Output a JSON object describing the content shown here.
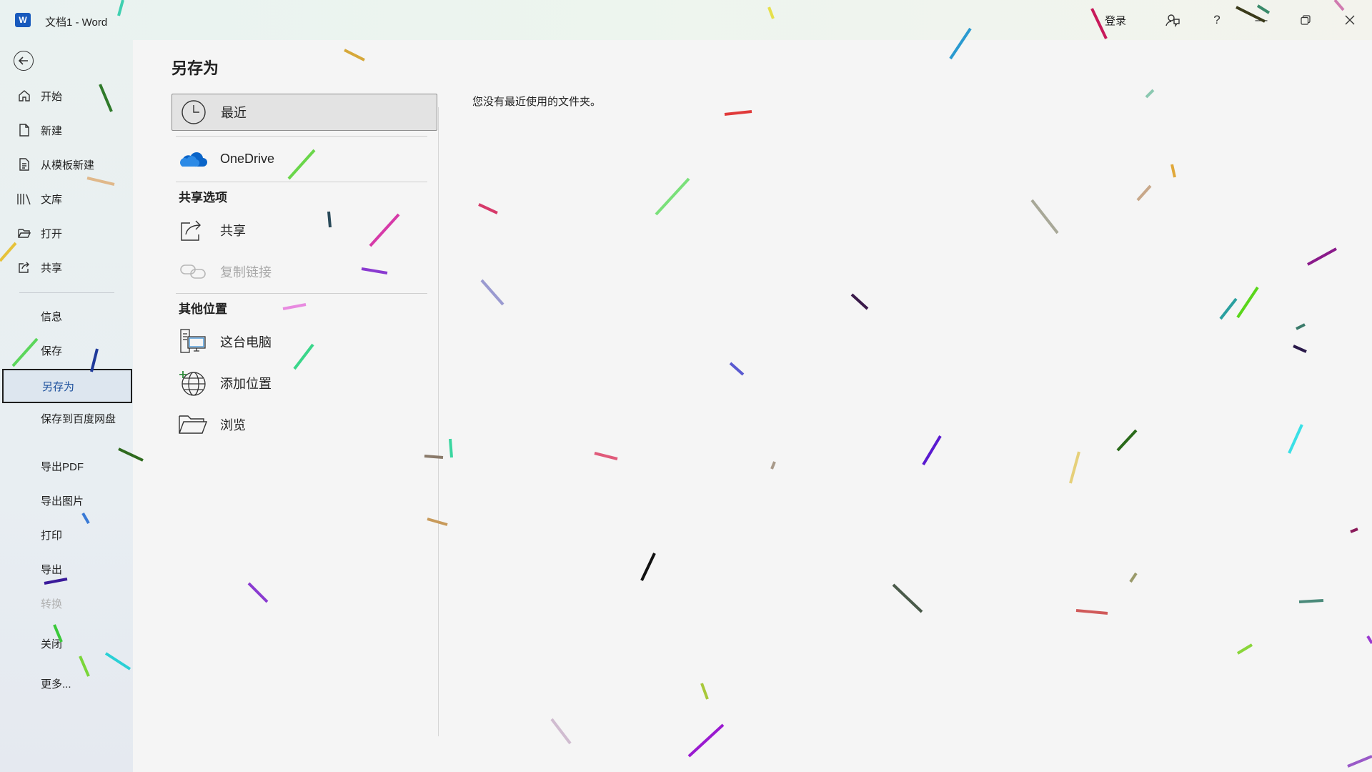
{
  "app": {
    "logo_letter": "W",
    "title": "文档1  -  Word",
    "sign_in": "登录",
    "help": "?",
    "minimize": "—"
  },
  "nav": {
    "items": [
      {
        "label": "开始",
        "icon": "home-icon"
      },
      {
        "label": "新建",
        "icon": "new-document-icon"
      },
      {
        "label": "从模板新建",
        "icon": "template-icon"
      },
      {
        "label": "文库",
        "icon": "library-icon"
      },
      {
        "label": "打开",
        "icon": "folder-open-icon"
      },
      {
        "label": "共享",
        "icon": "share-icon"
      }
    ],
    "plain_items": [
      {
        "label": "信息"
      },
      {
        "label": "保存"
      },
      {
        "label": "另存为",
        "selected": true
      },
      {
        "label": "保存到百度网盘"
      },
      {
        "label": "导出PDF"
      },
      {
        "label": "导出图片"
      },
      {
        "label": "打印"
      },
      {
        "label": "导出"
      },
      {
        "label": "转换",
        "disabled": true
      },
      {
        "label": "关闭"
      },
      {
        "label": "更多..."
      }
    ]
  },
  "page": {
    "title": "另存为",
    "locations": {
      "recent": "最近",
      "onedrive": "OneDrive",
      "sharing_header": "共享选项",
      "share": "共享",
      "copy_link": "复制链接",
      "other_header": "其他位置",
      "this_pc": "这台电脑",
      "add_place": "添加位置",
      "browse": "浏览"
    },
    "empty_message": "您没有最近使用的文件夹。"
  },
  "colors": {
    "accent": "#185abd",
    "selected_nav_text": "#1b4f9c",
    "onedrive_blue": "#0a64c8"
  }
}
